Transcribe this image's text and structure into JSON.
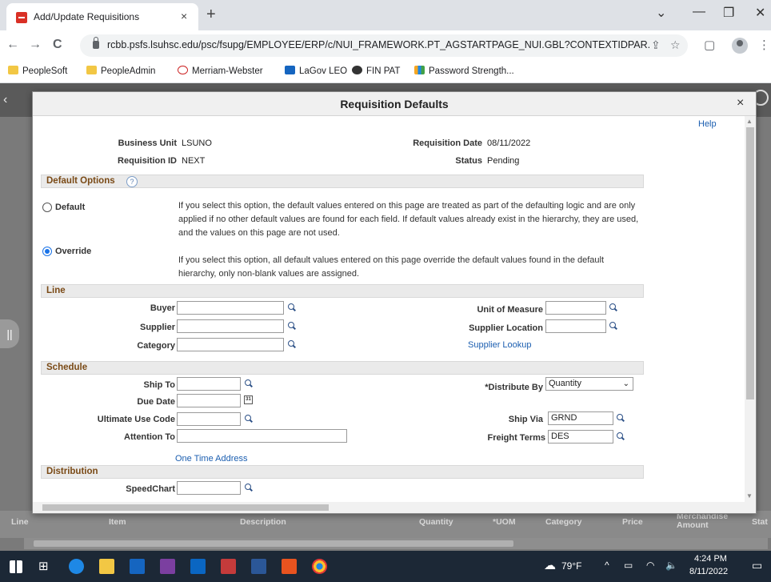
{
  "browser": {
    "tab_title": "Add/Update Requisitions",
    "tab_close": "×",
    "new_tab": "+",
    "url": "rcbb.psfs.lsuhsc.edu/psc/fsupg/EMPLOYEE/ERP/c/NUI_FRAMEWORK.PT_AGSTARTPAGE_NUI.GBL?CONTEXTIDPAR...",
    "win_minimize": "—",
    "win_restore": "❐",
    "win_close": "✕",
    "win_tabsearch": "⌄",
    "back": "←",
    "forward": "→",
    "reload": "C",
    "bookmarks": [
      "PeopleSoft",
      "PeopleAdmin",
      "Merriam-Webster",
      "LaGov LEO",
      "FIN PAT",
      "Password Strength..."
    ]
  },
  "modal": {
    "title": "Requisition Defaults",
    "close": "×",
    "help": "Help",
    "header": {
      "business_unit_label": "Business Unit",
      "business_unit": "LSUNO",
      "requisition_id_label": "Requisition ID",
      "requisition_id": "NEXT",
      "requisition_date_label": "Requisition Date",
      "requisition_date": "08/11/2022",
      "status_label": "Status",
      "status": "Pending"
    },
    "default_options": {
      "title": "Default Options",
      "help_icon": "?",
      "default_label": "Default",
      "default_desc": "If you select this option, the default values entered on this page are treated as part of the defaulting logic and are only applied if no other default values are found for each field. If default values already exist in the hierarchy, they are used, and the values on this page are not used.",
      "override_label": "Override",
      "override_desc": "If you select this option, all default values entered on this page override the default values found in the default hierarchy, only non-blank values are assigned.",
      "selected": "Override"
    },
    "line": {
      "title": "Line",
      "buyer_label": "Buyer",
      "buyer": "",
      "supplier_label": "Supplier",
      "supplier": "",
      "category_label": "Category",
      "category": "",
      "uom_label": "Unit of Measure",
      "uom": "",
      "supplier_location_label": "Supplier Location",
      "supplier_location": "",
      "supplier_lookup": "Supplier Lookup"
    },
    "schedule": {
      "title": "Schedule",
      "ship_to_label": "Ship To",
      "ship_to": "",
      "due_date_label": "Due Date",
      "due_date": "",
      "ultimate_use_label": "Ultimate Use Code",
      "ultimate_use": "",
      "attention_label": "Attention To",
      "attention": "",
      "one_time_address": "One Time Address",
      "distribute_by_label": "*Distribute By",
      "distribute_by": "Quantity",
      "ship_via_label": "Ship Via",
      "ship_via": "GRND",
      "freight_terms_label": "Freight Terms",
      "freight_terms": "DES"
    },
    "distribution": {
      "title": "Distribution",
      "speedchart_label": "SpeedChart",
      "speedchart": ""
    }
  },
  "background_table": {
    "columns": [
      "Line",
      "Item",
      "Description",
      "Quantity",
      "*UOM",
      "Category",
      "Price",
      "Merchandise Amount",
      "Stat"
    ]
  },
  "taskbar": {
    "weather": "79°F",
    "time": "4:24 PM",
    "date": "8/11/2022"
  }
}
